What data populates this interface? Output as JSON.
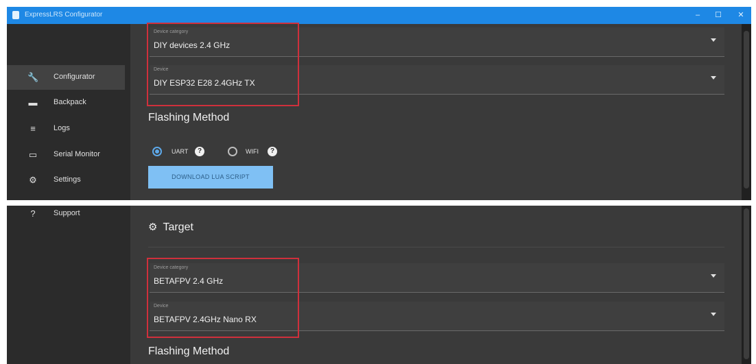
{
  "window": {
    "title": "ExpressLRS Configurator",
    "minimize_glyph": "–",
    "maximize_glyph": "☐",
    "close_glyph": "✕"
  },
  "sidebar": {
    "items": [
      {
        "label": "Configurator",
        "icon": "wrench-icon",
        "glyph": "🔧",
        "active": true
      },
      {
        "label": "Backpack",
        "icon": "sd-card-icon",
        "glyph": "▬",
        "active": false
      },
      {
        "label": "Logs",
        "icon": "list-icon",
        "glyph": "≡",
        "active": false
      },
      {
        "label": "Serial Monitor",
        "icon": "monitor-icon",
        "glyph": "▭",
        "active": false
      },
      {
        "label": "Settings",
        "icon": "gear-icon",
        "glyph": "⚙",
        "active": false
      },
      {
        "label": "Support",
        "icon": "help-circle-icon",
        "glyph": "?",
        "active": false
      }
    ]
  },
  "top_panel": {
    "device_category": {
      "label": "Device category",
      "value": "DIY devices 2.4 GHz"
    },
    "device": {
      "label": "Device",
      "value": "DIY ESP32 E28 2.4GHz TX"
    },
    "flashing_method_title": "Flashing Method",
    "radio_options": [
      {
        "label": "UART",
        "checked": true
      },
      {
        "label": "WIFI",
        "checked": false
      }
    ],
    "help_glyph": "?",
    "download_button": "DOWNLOAD LUA SCRIPT"
  },
  "bottom_panel": {
    "target_title": "Target",
    "target_glyph": "⚙",
    "device_category": {
      "label": "Device category",
      "value": "BETAFPV 2.4 GHz"
    },
    "device": {
      "label": "Device",
      "value": "BETAFPV 2.4GHz Nano RX"
    },
    "flashing_method_title": "Flashing Method"
  },
  "colors": {
    "titlebar": "#1e88e5",
    "accent": "#5ea9ea",
    "highlight_box": "#d0303c",
    "background": "#303030"
  }
}
